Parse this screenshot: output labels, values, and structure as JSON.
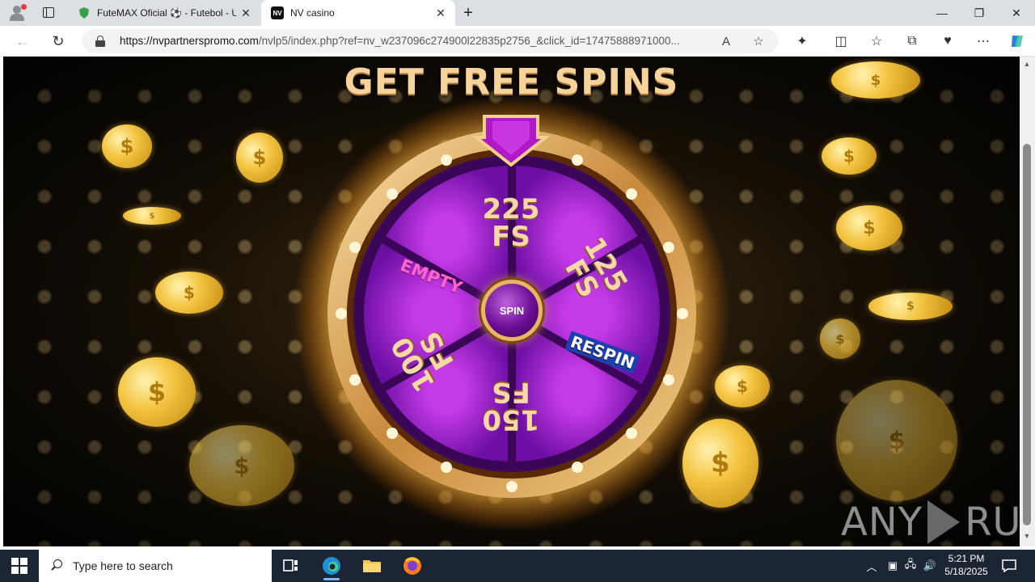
{
  "browser": {
    "tabs": [
      {
        "title": "FuteMAX Oficial ⚽ - Futebol - U",
        "icon": "shield-favicon"
      },
      {
        "title": "NV casino",
        "icon": "nv-favicon"
      }
    ],
    "nv_favicon_text": "NV",
    "url_host": "https://nvpartnerspromo.com",
    "url_path": "/nvlp5/index.php?ref=nv_w237096c274900l22835p2756_&click_id=17475888971000..."
  },
  "page": {
    "headline": "GET FREE SPINS",
    "spin_button": "SPIN",
    "segments": {
      "top_num": "225",
      "top_fs": "FS",
      "right_num": "125",
      "right_fs": "FS",
      "respin": "RESPIN",
      "bottom_num": "150",
      "bottom_fs": "FS",
      "left_num": "100",
      "left_fs": "FS",
      "empty": "EMPTY"
    },
    "coin_symbol": "$",
    "watermark_left": "ANY",
    "watermark_right": "RUN"
  },
  "taskbar": {
    "search_placeholder": "Type here to search",
    "time": "5:21 PM",
    "date": "5/18/2025"
  },
  "colors": {
    "wheel_purple": "#7a12b8",
    "wheel_gold": "#e8b563",
    "headline_gold": "#f6d39a"
  }
}
